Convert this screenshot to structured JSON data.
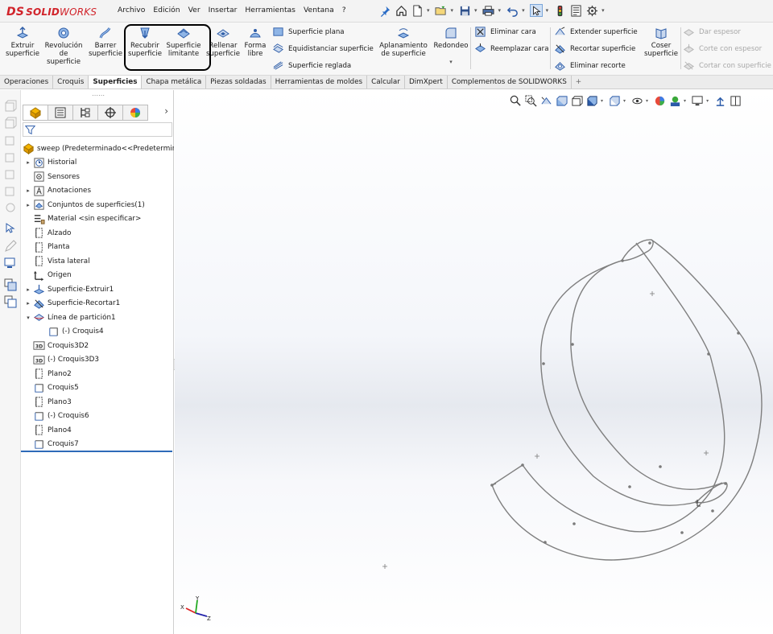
{
  "app": {
    "logo_ds": "DS",
    "logo_text": "SOLID",
    "logo_text2": "WORKS"
  },
  "menu": {
    "items": [
      "Archivo",
      "Edición",
      "Ver",
      "Insertar",
      "Herramientas",
      "Ventana",
      "?"
    ]
  },
  "quick_access": {
    "icons": [
      "pin-icon",
      "home-icon",
      "new-document-icon",
      "open-icon",
      "save-icon",
      "print-icon",
      "undo-icon",
      "select-icon",
      "rebuild-icon",
      "file-properties-icon",
      "options-icon"
    ]
  },
  "command_manager": {
    "big_buttons": [
      {
        "label1": "Extruir",
        "label2": "superficie",
        "label3": ""
      },
      {
        "label1": "Revolución",
        "label2": "de",
        "label3": "superficie"
      },
      {
        "label1": "Barrer",
        "label2": "superficie",
        "label3": ""
      },
      {
        "label1": "Recubrir",
        "label2": "superficie",
        "label3": ""
      },
      {
        "label1": "Superficie",
        "label2": "limitante",
        "label3": ""
      },
      {
        "label1": "Rellenar",
        "label2": "superficie",
        "label3": ""
      },
      {
        "label1": "Forma",
        "label2": "libre",
        "label3": ""
      }
    ],
    "col1": [
      "Superficie plana",
      "Equidistanciar superficie",
      "Superficie reglada"
    ],
    "flatten": {
      "label1": "Aplanamiento",
      "label2": "de superficie"
    },
    "fillet": {
      "label": "Redondeo"
    },
    "col2": [
      "Eliminar cara",
      "Reemplazar cara"
    ],
    "col3": [
      "Extender superficie",
      "Recortar superficie",
      "Eliminar recorte"
    ],
    "knit": {
      "label1": "Coser",
      "label2": "superficie"
    },
    "col4": [
      "Dar espesor",
      "Corte con espesor",
      "Cortar con superficie"
    ]
  },
  "tabs": {
    "items": [
      "Operaciones",
      "Croquis",
      "Superficies",
      "Chapa metálica",
      "Piezas soldadas",
      "Herramientas de moldes",
      "Calcular",
      "DimXpert",
      "Complementos de SOLIDWORKS",
      "+"
    ],
    "active": "Superficies"
  },
  "feature_manager": {
    "grip": "⋯⋯",
    "chevron": "›",
    "tree": [
      {
        "label": "sweep  (Predeterminado<<Predeterminado",
        "icon": "part-icon",
        "arrow": "",
        "indent": 0
      },
      {
        "label": "Historial",
        "icon": "history-icon",
        "arrow": "▸",
        "indent": 1
      },
      {
        "label": "Sensores",
        "icon": "sensors-icon",
        "arrow": "",
        "indent": 1
      },
      {
        "label": "Anotaciones",
        "icon": "annotations-icon",
        "arrow": "▸",
        "indent": 1
      },
      {
        "label": "Conjuntos de superficies(1)",
        "icon": "surface-bodies-icon",
        "arrow": "▸",
        "indent": 1
      },
      {
        "label": "Material <sin especificar>",
        "icon": "material-icon",
        "arrow": "",
        "indent": 1
      },
      {
        "label": "Alzado",
        "icon": "plane-icon",
        "arrow": "",
        "indent": 1
      },
      {
        "label": "Planta",
        "icon": "plane-icon",
        "arrow": "",
        "indent": 1
      },
      {
        "label": "Vista lateral",
        "icon": "plane-icon",
        "arrow": "",
        "indent": 1
      },
      {
        "label": "Origen",
        "icon": "origin-icon",
        "arrow": "",
        "indent": 1
      },
      {
        "label": "Superficie-Extruir1",
        "icon": "surface-extrude-icon",
        "arrow": "▸",
        "indent": 1
      },
      {
        "label": "Superficie-Recortar1",
        "icon": "surface-trim-icon",
        "arrow": "▸",
        "indent": 1
      },
      {
        "label": "Línea de partición1",
        "icon": "split-line-icon",
        "arrow": "▾",
        "indent": 1
      },
      {
        "label": "(-) Croquis4",
        "icon": "sketch-icon",
        "arrow": "",
        "indent": 2
      },
      {
        "label": "Croquis3D2",
        "icon": "sketch-3d-icon",
        "arrow": "",
        "indent": 1
      },
      {
        "label": "(-) Croquis3D3",
        "icon": "sketch-3d-icon",
        "arrow": "",
        "indent": 1
      },
      {
        "label": "Plano2",
        "icon": "plane-icon",
        "arrow": "",
        "indent": 1
      },
      {
        "label": "Croquis5",
        "icon": "sketch-icon",
        "arrow": "",
        "indent": 1
      },
      {
        "label": "Plano3",
        "icon": "plane-icon",
        "arrow": "",
        "indent": 1
      },
      {
        "label": "(-) Croquis6",
        "icon": "sketch-icon",
        "arrow": "",
        "indent": 1
      },
      {
        "label": "Plano4",
        "icon": "plane-icon",
        "arrow": "",
        "indent": 1
      },
      {
        "label": "Croquis7",
        "icon": "sketch-icon",
        "arrow": "",
        "indent": 1
      }
    ]
  },
  "graphics": {
    "view_icons": [
      "zoom-to-fit-icon",
      "zoom-area-icon",
      "previous-view-icon",
      "section-view-icon",
      "dynamic-annotation-icon",
      "view-orientation-icon",
      "display-style-icon",
      "hide-show-icon",
      "appearance-icon",
      "scene-icon",
      "view-settings-icon",
      "display-icon",
      "viewport-icon"
    ],
    "triad": {
      "x": "X",
      "y": "Y",
      "z": "Z"
    }
  },
  "colors": {
    "accent": "#2e6ab8",
    "logo_red": "#d1232a",
    "curve": "#808080",
    "highlight_box": "#000000"
  }
}
